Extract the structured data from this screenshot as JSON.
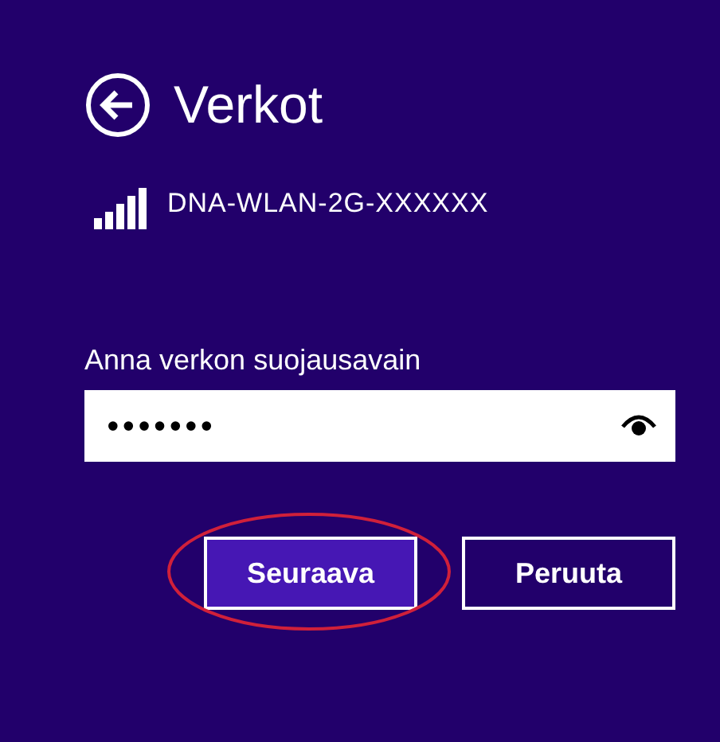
{
  "header": {
    "title": "Verkot"
  },
  "network": {
    "name": "DNA-WLAN-2G-XXXXXX"
  },
  "key_field": {
    "label": "Anna verkon suojausavain",
    "value": "•••••••"
  },
  "buttons": [
    {
      "label": "Seuraava",
      "kind": "primary",
      "highlighted": true
    },
    {
      "label": "Peruuta",
      "kind": "secondary",
      "highlighted": false
    }
  ]
}
